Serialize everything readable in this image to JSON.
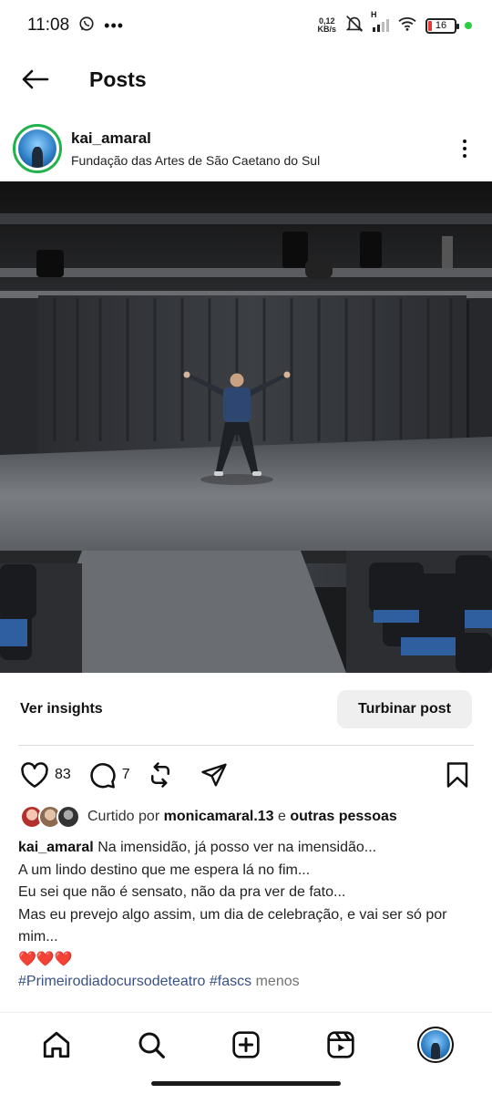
{
  "status_bar": {
    "time": "11:08",
    "net_speed_value": "0,12",
    "net_speed_unit": "KB/s",
    "signal_label": "H",
    "battery": "16",
    "battery_color": "#e53935",
    "online_dot_color": "#2ecc40"
  },
  "header": {
    "title": "Posts"
  },
  "post": {
    "username": "kai_amaral",
    "location": "Fundação das Artes de São Caetano do Sul",
    "avatar_ring_color": "#22b24c"
  },
  "insights": {
    "link_label": "Ver insights",
    "boost_label": "Turbinar post"
  },
  "actions": {
    "likes": "83",
    "comments": "7"
  },
  "liked_by": {
    "prefix": "Curtido por",
    "user": "monicamaral.13",
    "connector": "e",
    "others": "outras pessoas"
  },
  "caption": {
    "username": "kai_amaral",
    "line1": "Na imensidão, já posso ver na imensidão...",
    "line2": "A um lindo destino que me espera lá no fim...",
    "line3": "Eu sei que não é sensato, não da pra ver de fato...",
    "line4": "Mas eu prevejo algo assim, um dia de celebração, e vai ser só por mim...",
    "emojis": "❤️❤️❤️",
    "hashtags": "#Primeirodiadocursodeteatro #fascs",
    "less_label": "menos"
  },
  "icons": {
    "back": "arrow-left-icon",
    "more": "more-vertical-icon",
    "like": "heart-icon",
    "comment": "comment-icon",
    "repost": "repost-icon",
    "share": "send-icon",
    "save": "bookmark-icon",
    "nav": [
      "home-icon",
      "search-icon",
      "create-icon",
      "reels-icon",
      "profile-avatar"
    ]
  },
  "colors": {
    "hashtag": "#385185",
    "muted": "#737373",
    "button_bg": "#efefef"
  }
}
